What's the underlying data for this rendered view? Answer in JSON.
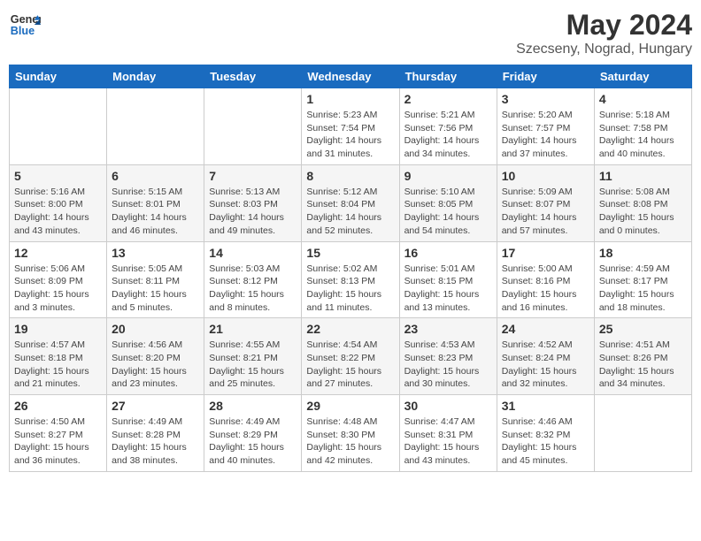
{
  "logo": {
    "line1": "General",
    "line2": "Blue"
  },
  "title": "May 2024",
  "subtitle": "Szecseny, Nograd, Hungary",
  "weekdays": [
    "Sunday",
    "Monday",
    "Tuesday",
    "Wednesday",
    "Thursday",
    "Friday",
    "Saturday"
  ],
  "weeks": [
    [
      {
        "day": "",
        "info": ""
      },
      {
        "day": "",
        "info": ""
      },
      {
        "day": "",
        "info": ""
      },
      {
        "day": "1",
        "info": "Sunrise: 5:23 AM\nSunset: 7:54 PM\nDaylight: 14 hours\nand 31 minutes."
      },
      {
        "day": "2",
        "info": "Sunrise: 5:21 AM\nSunset: 7:56 PM\nDaylight: 14 hours\nand 34 minutes."
      },
      {
        "day": "3",
        "info": "Sunrise: 5:20 AM\nSunset: 7:57 PM\nDaylight: 14 hours\nand 37 minutes."
      },
      {
        "day": "4",
        "info": "Sunrise: 5:18 AM\nSunset: 7:58 PM\nDaylight: 14 hours\nand 40 minutes."
      }
    ],
    [
      {
        "day": "5",
        "info": "Sunrise: 5:16 AM\nSunset: 8:00 PM\nDaylight: 14 hours\nand 43 minutes."
      },
      {
        "day": "6",
        "info": "Sunrise: 5:15 AM\nSunset: 8:01 PM\nDaylight: 14 hours\nand 46 minutes."
      },
      {
        "day": "7",
        "info": "Sunrise: 5:13 AM\nSunset: 8:03 PM\nDaylight: 14 hours\nand 49 minutes."
      },
      {
        "day": "8",
        "info": "Sunrise: 5:12 AM\nSunset: 8:04 PM\nDaylight: 14 hours\nand 52 minutes."
      },
      {
        "day": "9",
        "info": "Sunrise: 5:10 AM\nSunset: 8:05 PM\nDaylight: 14 hours\nand 54 minutes."
      },
      {
        "day": "10",
        "info": "Sunrise: 5:09 AM\nSunset: 8:07 PM\nDaylight: 14 hours\nand 57 minutes."
      },
      {
        "day": "11",
        "info": "Sunrise: 5:08 AM\nSunset: 8:08 PM\nDaylight: 15 hours\nand 0 minutes."
      }
    ],
    [
      {
        "day": "12",
        "info": "Sunrise: 5:06 AM\nSunset: 8:09 PM\nDaylight: 15 hours\nand 3 minutes."
      },
      {
        "day": "13",
        "info": "Sunrise: 5:05 AM\nSunset: 8:11 PM\nDaylight: 15 hours\nand 5 minutes."
      },
      {
        "day": "14",
        "info": "Sunrise: 5:03 AM\nSunset: 8:12 PM\nDaylight: 15 hours\nand 8 minutes."
      },
      {
        "day": "15",
        "info": "Sunrise: 5:02 AM\nSunset: 8:13 PM\nDaylight: 15 hours\nand 11 minutes."
      },
      {
        "day": "16",
        "info": "Sunrise: 5:01 AM\nSunset: 8:15 PM\nDaylight: 15 hours\nand 13 minutes."
      },
      {
        "day": "17",
        "info": "Sunrise: 5:00 AM\nSunset: 8:16 PM\nDaylight: 15 hours\nand 16 minutes."
      },
      {
        "day": "18",
        "info": "Sunrise: 4:59 AM\nSunset: 8:17 PM\nDaylight: 15 hours\nand 18 minutes."
      }
    ],
    [
      {
        "day": "19",
        "info": "Sunrise: 4:57 AM\nSunset: 8:18 PM\nDaylight: 15 hours\nand 21 minutes."
      },
      {
        "day": "20",
        "info": "Sunrise: 4:56 AM\nSunset: 8:20 PM\nDaylight: 15 hours\nand 23 minutes."
      },
      {
        "day": "21",
        "info": "Sunrise: 4:55 AM\nSunset: 8:21 PM\nDaylight: 15 hours\nand 25 minutes."
      },
      {
        "day": "22",
        "info": "Sunrise: 4:54 AM\nSunset: 8:22 PM\nDaylight: 15 hours\nand 27 minutes."
      },
      {
        "day": "23",
        "info": "Sunrise: 4:53 AM\nSunset: 8:23 PM\nDaylight: 15 hours\nand 30 minutes."
      },
      {
        "day": "24",
        "info": "Sunrise: 4:52 AM\nSunset: 8:24 PM\nDaylight: 15 hours\nand 32 minutes."
      },
      {
        "day": "25",
        "info": "Sunrise: 4:51 AM\nSunset: 8:26 PM\nDaylight: 15 hours\nand 34 minutes."
      }
    ],
    [
      {
        "day": "26",
        "info": "Sunrise: 4:50 AM\nSunset: 8:27 PM\nDaylight: 15 hours\nand 36 minutes."
      },
      {
        "day": "27",
        "info": "Sunrise: 4:49 AM\nSunset: 8:28 PM\nDaylight: 15 hours\nand 38 minutes."
      },
      {
        "day": "28",
        "info": "Sunrise: 4:49 AM\nSunset: 8:29 PM\nDaylight: 15 hours\nand 40 minutes."
      },
      {
        "day": "29",
        "info": "Sunrise: 4:48 AM\nSunset: 8:30 PM\nDaylight: 15 hours\nand 42 minutes."
      },
      {
        "day": "30",
        "info": "Sunrise: 4:47 AM\nSunset: 8:31 PM\nDaylight: 15 hours\nand 43 minutes."
      },
      {
        "day": "31",
        "info": "Sunrise: 4:46 AM\nSunset: 8:32 PM\nDaylight: 15 hours\nand 45 minutes."
      },
      {
        "day": "",
        "info": ""
      }
    ]
  ]
}
